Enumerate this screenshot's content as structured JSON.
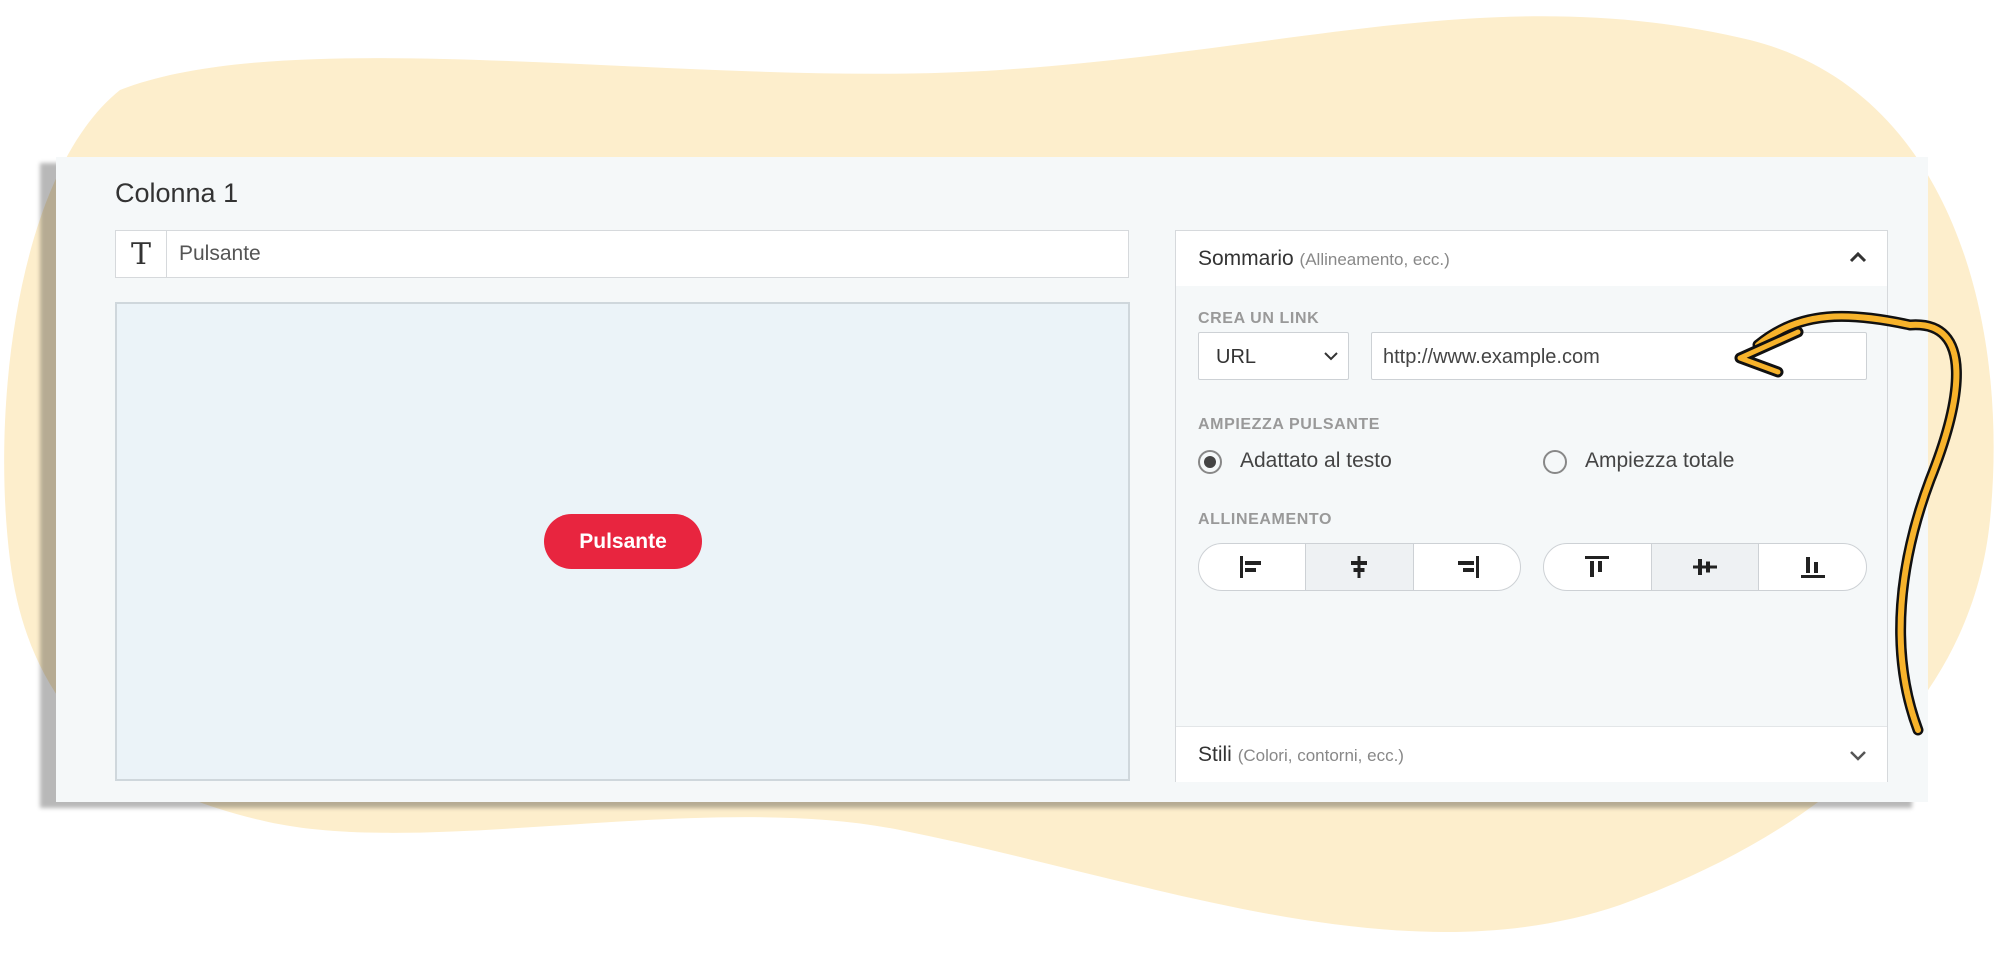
{
  "column": {
    "title": "Colonna 1"
  },
  "text_input": {
    "icon": "text-type-icon",
    "value": "Pulsante"
  },
  "preview": {
    "button_label": "Pulsante",
    "button_color": "#e8253f"
  },
  "summary": {
    "title": "Sommario",
    "hint": "(Allineamento, ecc.)",
    "link_section": {
      "label": "CREA UN LINK",
      "type_value": "URL",
      "url_value": "http://www.example.com"
    },
    "width_section": {
      "label": "AMPIEZZA PULSANTE",
      "options": [
        {
          "label": "Adattato al testo",
          "selected": true
        },
        {
          "label": "Ampiezza totale",
          "selected": false
        }
      ]
    },
    "alignment_section": {
      "label": "ALLINEAMENTO",
      "horizontal": [
        "align-left-icon",
        "align-center-icon",
        "align-right-icon"
      ],
      "horizontal_selected": "align-center-icon",
      "vertical": [
        "align-top-icon",
        "align-middle-icon",
        "align-bottom-icon"
      ],
      "vertical_selected": "align-middle-icon"
    }
  },
  "styles": {
    "title": "Stili",
    "hint": "(Colori, contorni, ecc.)"
  },
  "colors": {
    "blob": "#fdeecc",
    "arrow": "#f7b32b",
    "accent": "#e8253f"
  }
}
